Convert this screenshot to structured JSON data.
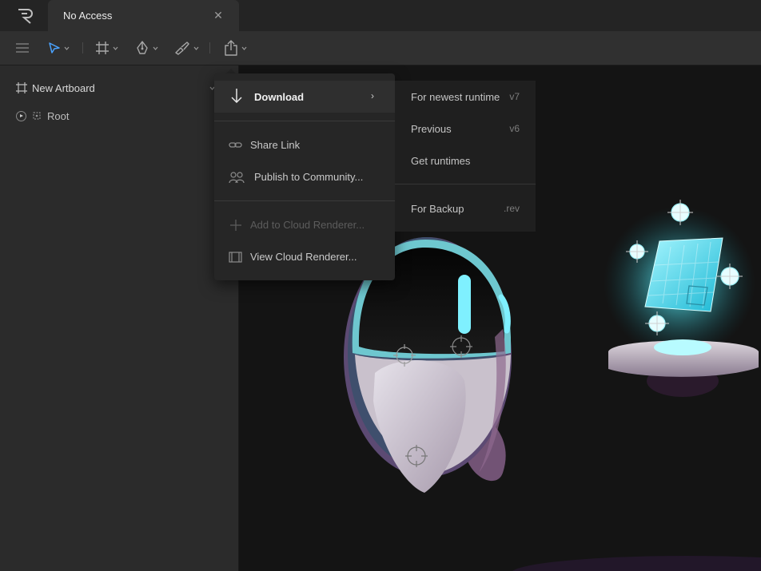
{
  "app": {
    "logo_letter": "R",
    "tab_title": "No Access",
    "tab_close": "✕"
  },
  "toolbar": {
    "tools": [
      {
        "name": "menu",
        "icon": "hamburger-icon"
      },
      {
        "name": "select",
        "icon": "cursor-arrow-icon",
        "active_color": "#4aa3ff"
      },
      {
        "name": "artboard",
        "icon": "artboard-frame-icon"
      },
      {
        "name": "pen",
        "icon": "pen-nib-icon"
      },
      {
        "name": "brush",
        "icon": "brush-icon"
      },
      {
        "name": "export",
        "icon": "share-export-icon"
      }
    ]
  },
  "sidebar": {
    "artboard_label": "New Artboard",
    "root_label": "Root"
  },
  "menu": {
    "download": "Download",
    "share_link": "Share Link",
    "publish": "Publish to Community...",
    "add_cloud": "Add to Cloud Renderer...",
    "view_cloud": "View Cloud Renderer...",
    "submenu_caret": "›"
  },
  "submenu": {
    "items": [
      {
        "label": "For newest runtime",
        "suffix": "v7"
      },
      {
        "label": "Previous",
        "suffix": "v6"
      },
      {
        "label": "Get runtimes",
        "suffix": ""
      },
      {
        "label": "For Backup",
        "suffix": ".rev"
      }
    ]
  },
  "colors": {
    "accent": "#4aa3ff",
    "cyan_glow": "#5fe8f2",
    "panel": "#2b2b2b"
  }
}
